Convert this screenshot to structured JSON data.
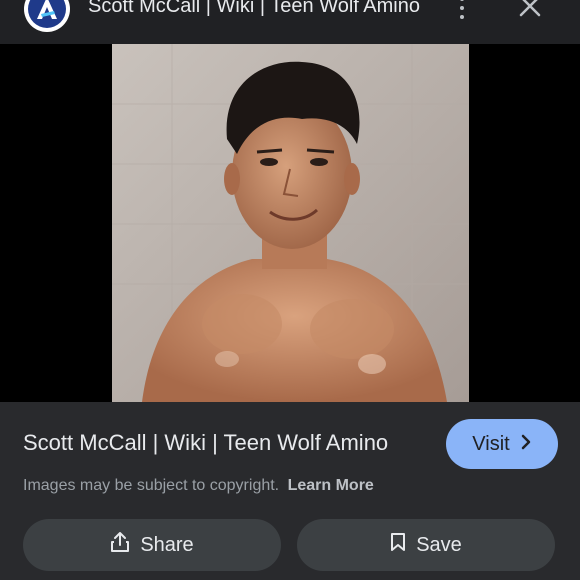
{
  "header": {
    "site_icon": "amino-logo-icon",
    "title": "Scott McCall | Wiki | Teen Wolf Amino",
    "more_icon": "more-vert-icon",
    "close_icon": "close-icon"
  },
  "image": {
    "description_icon": "photo"
  },
  "result": {
    "title": "Scott McCall | Wiki | Teen Wolf Amino",
    "visit_label": "Visit",
    "visit_icon": "chevron-right-icon",
    "copyright_text": "Images may be subject to copyright.",
    "learn_more_label": "Learn More"
  },
  "actions": {
    "share_label": "Share",
    "share_icon": "share-icon",
    "save_label": "Save",
    "save_icon": "bookmark-icon"
  },
  "colors": {
    "background": "#202124",
    "panel": "#292a2d",
    "button": "#3c4043",
    "accent": "#8ab4f8"
  }
}
